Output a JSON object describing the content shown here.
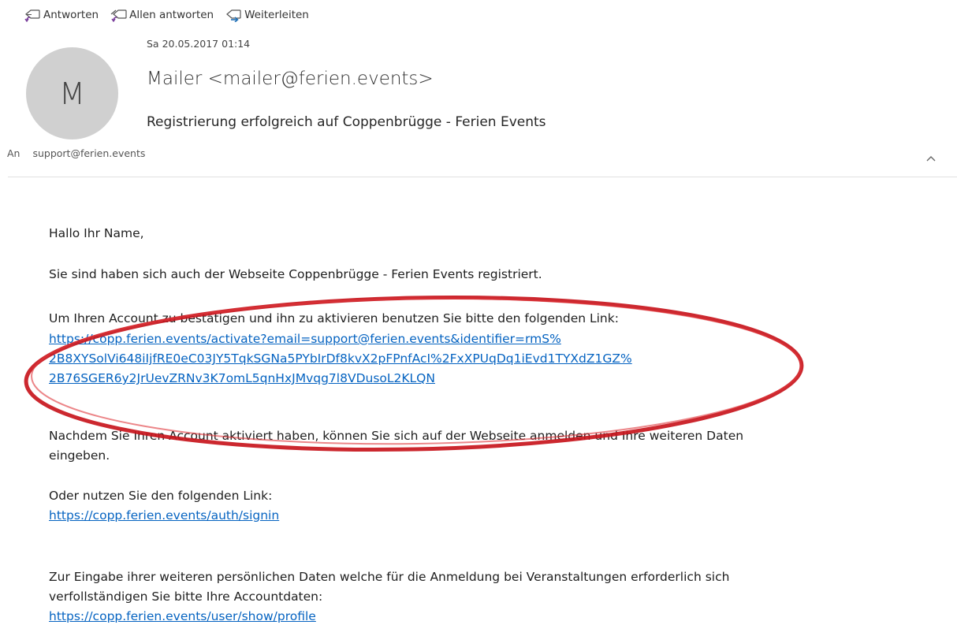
{
  "toolbar": {
    "reply_label": "Antworten",
    "reply_all_label": "Allen antworten",
    "forward_label": "Weiterleiten"
  },
  "message": {
    "date": "Sa 20.05.2017 01:14",
    "avatar_initial": "M",
    "sender": "Mailer <mailer@ferien.events>",
    "subject": "Registrierung erfolgreich auf Coppenbrügge - Ferien Events",
    "to_label": "An",
    "to_address": "support@ferien.events"
  },
  "body": {
    "greeting": "Hallo Ihr Name,",
    "intro": "Sie sind haben sich auch der Webseite Coppenbrügge - Ferien Events registriert.",
    "activate_text": "Um Ihren Account zu bestätigen und ihn zu aktivieren benutzen Sie bitte den folgenden Link:",
    "activate_link_line1": "https://copp.ferien.events/activate?email=support@ferien.events&identifier=rmS%",
    "activate_link_line2": "2B8XYSolVi648iIjfRE0eC03JY5TqkSGNa5PYbIrDf8kvX2pFPnfAcI%2FxXPUqDq1iEvd1TYXdZ1GZ%",
    "activate_link_line3": "2B76SGER6y2JrUevZRNv3K7omL5qnHxJMvqg7l8VDusoL2KLQN",
    "after_activate_line1": "Nachdem Sie Ihren Account aktiviert haben, können Sie sich auf der Webseite anmelden und Ihre weiteren Daten",
    "after_activate_line2": "eingeben.",
    "alt_link_text": "Oder nutzen Sie den folgenden Link:",
    "signin_link": "https://copp.ferien.events/auth/signin",
    "profile_text_line1": "Zur Eingabe ihrer weiteren persönlichen Daten welche für die Anmeldung bei Veranstaltungen erforderlich sich",
    "profile_text_line2": "verfollständigen Sie bitte Ihre Accountdaten:",
    "profile_link": "https://copp.ferien.events/user/show/profile"
  },
  "colors": {
    "link": "#0563c1",
    "annotation_ring": "#c8161d",
    "avatar_bg": "#d0d0d0"
  }
}
